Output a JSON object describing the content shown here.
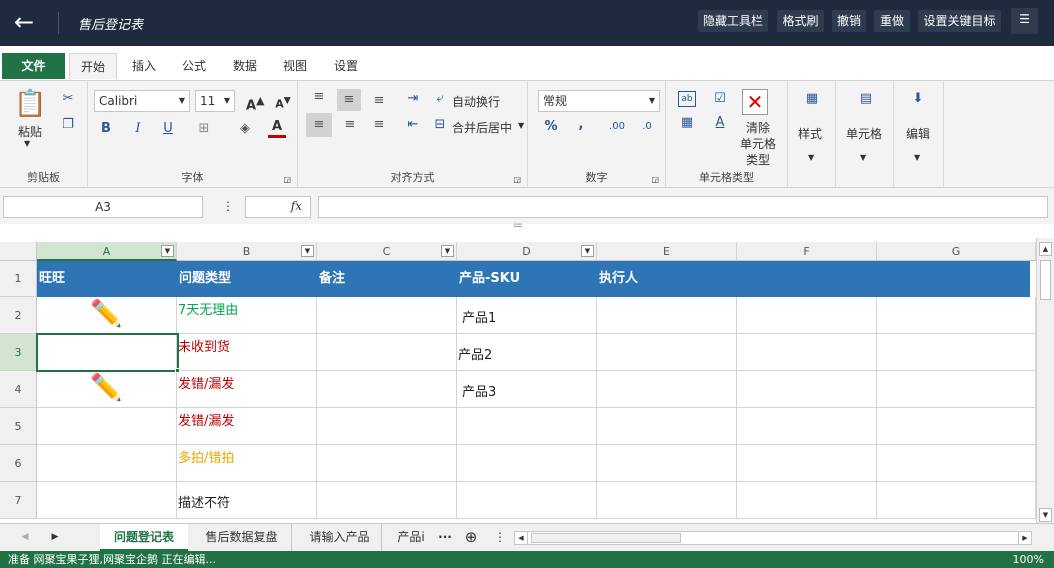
{
  "topbar": {
    "title": "售后登记表",
    "buttons": [
      "隐藏工具栏",
      "格式刷",
      "撤销",
      "重做",
      "设置关键目标"
    ]
  },
  "menu": {
    "file": "文件",
    "tabs": [
      "开始",
      "插入",
      "公式",
      "数据",
      "视图",
      "设置"
    ],
    "active": "开始"
  },
  "ribbon": {
    "clipboard": {
      "paste": "粘贴",
      "label": "剪贴板"
    },
    "font": {
      "name": "Calibri",
      "size": "11",
      "label": "字体",
      "bold": "B",
      "italic": "I",
      "underline": "U"
    },
    "align": {
      "wrap": "自动换行",
      "merge": "合并后居中",
      "label": "对齐方式"
    },
    "number": {
      "format": "常规",
      "percent": "%",
      "comma": ",",
      "label": "数字"
    },
    "celltype": {
      "clear_line1": "清除",
      "clear_line2": "单元格",
      "clear_line3": "类型",
      "label": "单元格类型"
    },
    "style": {
      "label": "样式"
    },
    "cells": {
      "label": "单元格"
    },
    "edit": {
      "label": "编辑"
    }
  },
  "formula": {
    "namebox": "A3",
    "fx": "fx",
    "content": ""
  },
  "grid": {
    "columns": [
      "A",
      "B",
      "C",
      "D",
      "E",
      "F",
      "G"
    ],
    "rows": [
      "1",
      "2",
      "3",
      "4",
      "5",
      "6",
      "7"
    ],
    "header": [
      "旺旺",
      "问题类型",
      "备注",
      "产品-SKU",
      "执行人",
      "",
      ""
    ],
    "types": [
      {
        "text": "7天无理由",
        "color": "#00a651"
      },
      {
        "text": "未收到货",
        "color": "#c00000"
      },
      {
        "text": "发错/漏发",
        "color": "#c00000"
      },
      {
        "text": "发错/漏发",
        "color": "#c00000"
      },
      {
        "text": "多拍/错拍",
        "color": "#e6a700"
      },
      {
        "text": "描述不符",
        "color": "#222222"
      }
    ],
    "products": [
      "产品1",
      "产品2",
      "产品3"
    ],
    "header_color": "#2e75b6"
  },
  "sheets": {
    "tabs": [
      "问题登记表",
      "售后数据复盘",
      "请输入产品",
      "产品i"
    ],
    "more": "···"
  },
  "status": {
    "left": "准备 网聚宝果子狸,网聚宝企鹅 正在编辑...",
    "zoom": "100%"
  }
}
